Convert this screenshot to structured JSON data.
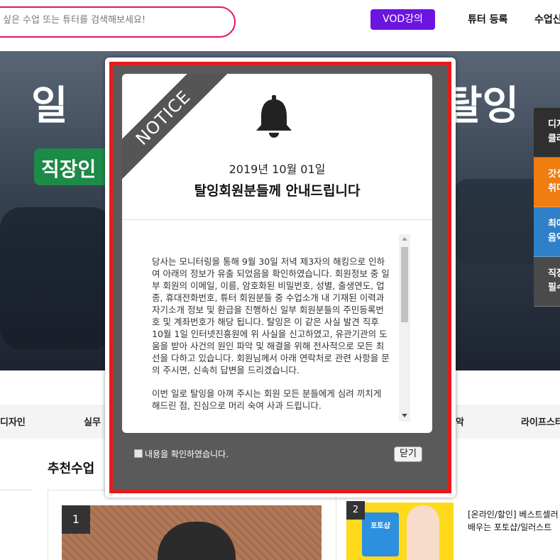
{
  "header": {
    "search_placeholder": "싶은 수업 또는 튜터를 검색해보세요!",
    "vod_label": "VOD강의",
    "nav": [
      "튜터 등록",
      "수업신"
    ]
  },
  "hero": {
    "title_left": "일 ",
    "title_right": "탈잉",
    "badge": "직장인",
    "side_tabs": [
      {
        "label": "디지\n클라",
        "color": "#2f2f2f"
      },
      {
        "label": "갓생\n취미",
        "color": "#ef7d0f"
      },
      {
        "label": "최애\n음악",
        "color": "#2f80c8"
      },
      {
        "label": "직장\n필수",
        "color": "#4a4a4a"
      }
    ]
  },
  "categories": [
    "디자인",
    "실무",
    "악",
    "라이프스타"
  ],
  "recommended": {
    "title": "추천수업",
    "items": [
      {
        "rank": "1"
      },
      {
        "rank": "2",
        "title_line1": "[온라인/할인] 베스트셀러",
        "title_line2": "배우는 포토샵/일러스트",
        "thumb_text": "포토샵"
      }
    ]
  },
  "modal": {
    "ribbon": "NOTICE",
    "date": "2019년 10월 01일",
    "headline": "탈잉회원분들께 안내드립니다",
    "paragraphs": [
      "당사는 모니터링을 통해 9월 30일 저녁 제3자의 해킹으로 인하여 아래의 정보가 유출 되었음을 확인하였습니다. 회원정보 중 일부 회원의 이메일, 이름, 암호화된 비밀번호, 성별, 출생연도, 업종, 휴대전화번호, 튜터 회원분들 중 수업소개 내 기재된 이력과 자기소개 정보 및 환급을 진행하신 일부 회원분들의 주민등록번호 및 계좌번호가 해당 됩니다. 탈잉은 이 같은 사실 발견 직후 10월 1일 인터넷진흥원에 위 사실을 신고하였고, 유관기관의 도움을 받아 사건의 원인 파악 및 해결을 위해 전사적으로 모든 최선을 다하고 있습니다. 회원님께서 아래 연락처로 관련 사항을 문의 주시면, 신속히 답변을 드리겠습니다.",
      "이번 일로 탈잉을 아껴 주시는 회원 모든 분들에게 심려 끼치게 해드린 점, 진심으로 머리 숙여 사과 드립니다."
    ],
    "confirm_label": "내용을 확인하였습니다.",
    "close_label": "닫기"
  }
}
